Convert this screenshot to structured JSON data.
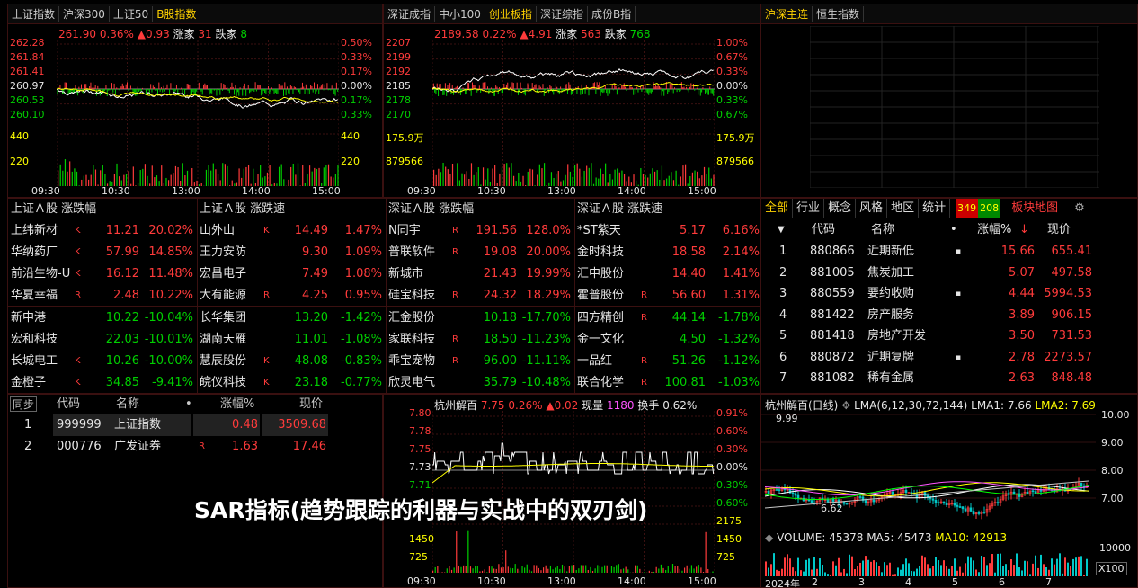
{
  "panel1": {
    "tabs": [
      "上证指数",
      "沪深300",
      "上证50",
      "B股指数"
    ],
    "active": 3,
    "header": {
      "price": "261.90",
      "pct": "0.36%",
      "chg": "▲0.93",
      "up_label": "涨家",
      "up": "31",
      "down_label": "跌家",
      "down": "8"
    },
    "yleft": [
      "262.28",
      "261.84",
      "261.41",
      "260.97",
      "260.53",
      "260.10"
    ],
    "yright": [
      "0.50%",
      "0.33%",
      "0.17%",
      "0.00%",
      "0.17%",
      "0.33%"
    ],
    "vol_left": [
      "440",
      "220"
    ],
    "vol_right": [
      "440",
      "220"
    ],
    "times": [
      "09:30",
      "10:30",
      "13:00",
      "14:00",
      "15:00"
    ]
  },
  "panel2": {
    "tabs": [
      "深证成指",
      "中小100",
      "创业板指",
      "深证综指",
      "成份B指"
    ],
    "active": 2,
    "header": {
      "price": "2189.58",
      "pct": "0.22%",
      "chg": "▲4.91",
      "up_label": "涨家",
      "up": "563",
      "down_label": "跌家",
      "down": "768"
    },
    "yleft": [
      "2207",
      "2199",
      "2192",
      "2185",
      "2178",
      "2170"
    ],
    "yright": [
      "1.00%",
      "0.67%",
      "0.33%",
      "0.00%",
      "0.33%",
      "0.67%"
    ],
    "vol_left": [
      "175.9万",
      "879566"
    ],
    "vol_right": [
      "175.9万",
      "879566"
    ],
    "times": [
      "09:30",
      "10:30",
      "13:00",
      "14:00",
      "15:00"
    ]
  },
  "panel3": {
    "tabs": [
      "沪深主连",
      "恒生指数"
    ],
    "active": 0
  },
  "rank": {
    "cols": [
      {
        "title": "上证Ａ股 涨跌幅",
        "rows": [
          [
            "上纬新材",
            "K",
            "11.21",
            "20.02%",
            "r"
          ],
          [
            "华纳药厂",
            "K",
            "57.99",
            "14.85%",
            "r"
          ],
          [
            "前沿生物-U",
            "K",
            "16.12",
            "11.48%",
            "r"
          ],
          [
            "华夏幸福",
            "R",
            "2.48",
            "10.22%",
            "r"
          ],
          [
            "新中港",
            "",
            "10.22",
            "-10.04%",
            "g"
          ],
          [
            "宏和科技",
            "",
            "22.03",
            "-10.01%",
            "g"
          ],
          [
            "长城电工",
            "K",
            "10.26",
            "-10.00%",
            "g"
          ],
          [
            "金橙子",
            "K",
            "34.85",
            "-9.41%",
            "g"
          ]
        ]
      },
      {
        "title": "上证Ａ股 涨跌速",
        "rows": [
          [
            "山外山",
            "K",
            "14.49",
            "1.47%",
            "r"
          ],
          [
            "王力安防",
            "",
            "9.30",
            "1.09%",
            "r"
          ],
          [
            "宏昌电子",
            "",
            "7.49",
            "1.08%",
            "r"
          ],
          [
            "大有能源",
            "R",
            "4.25",
            "0.95%",
            "r"
          ],
          [
            "长华集团",
            "",
            "13.20",
            "-1.42%",
            "g"
          ],
          [
            "湖南天雁",
            "",
            "11.01",
            "-1.08%",
            "g"
          ],
          [
            "慧辰股份",
            "K",
            "48.08",
            "-0.83%",
            "g"
          ],
          [
            "皖仪科技",
            "K",
            "23.18",
            "-0.77%",
            "g"
          ]
        ]
      },
      {
        "title": "深证Ａ股 涨跌幅",
        "rows": [
          [
            "N同宇",
            "R",
            "191.56",
            "128.0%",
            "r"
          ],
          [
            "普联软件",
            "R",
            "19.08",
            "20.00%",
            "r"
          ],
          [
            "新城市",
            "",
            "21.43",
            "19.99%",
            "r"
          ],
          [
            "硅宝科技",
            "R",
            "24.32",
            "18.29%",
            "r"
          ],
          [
            "汇金股份",
            "",
            "10.18",
            "-17.70%",
            "g"
          ],
          [
            "家联科技",
            "R",
            "18.50",
            "-11.23%",
            "g"
          ],
          [
            "乖宝宠物",
            "R",
            "96.00",
            "-11.11%",
            "g"
          ],
          [
            "欣灵电气",
            "",
            "35.79",
            "-10.48%",
            "g"
          ]
        ]
      },
      {
        "title": "深证Ａ股 涨跌速",
        "rows": [
          [
            "*ST紫天",
            "",
            "5.17",
            "6.16%",
            "r"
          ],
          [
            "金时科技",
            "",
            "18.58",
            "2.14%",
            "r"
          ],
          [
            "汇中股份",
            "",
            "14.40",
            "1.41%",
            "r"
          ],
          [
            "霍普股份",
            "R",
            "56.60",
            "1.31%",
            "r"
          ],
          [
            "四方精创",
            "R",
            "44.14",
            "-1.78%",
            "g"
          ],
          [
            "金一文化",
            "",
            "4.50",
            "-1.32%",
            "g"
          ],
          [
            "一品红",
            "R",
            "51.26",
            "-1.12%",
            "g"
          ],
          [
            "联合化学",
            "R",
            "100.81",
            "-1.03%",
            "g"
          ]
        ]
      }
    ]
  },
  "sector": {
    "tabs": [
      "全部",
      "行业",
      "概念",
      "风格",
      "地区",
      "统计"
    ],
    "count_up": "349",
    "count_down": "208",
    "map_label": "板块地图",
    "head": {
      "code": "代码",
      "name": "名称",
      "pct": "涨幅%",
      "price": "现价"
    },
    "rows": [
      [
        "1",
        "880866",
        "近期新低",
        "▪",
        "15.66",
        "655.41"
      ],
      [
        "2",
        "881005",
        "焦炭加工",
        "",
        "5.07",
        "497.58"
      ],
      [
        "3",
        "880559",
        "要约收购",
        "▪",
        "4.44",
        "5994.53"
      ],
      [
        "4",
        "881422",
        "房产服务",
        "",
        "3.89",
        "906.15"
      ],
      [
        "5",
        "881418",
        "房地产开发",
        "",
        "3.50",
        "731.53"
      ],
      [
        "6",
        "880872",
        "近期复牌",
        "▪",
        "2.78",
        "2273.57"
      ],
      [
        "7",
        "881082",
        "稀有金属",
        "",
        "2.63",
        "848.48"
      ]
    ]
  },
  "watch": {
    "sync": "同步",
    "head": {
      "code": "代码",
      "name": "名称",
      "pct": "涨幅%",
      "price": "现价"
    },
    "rows": [
      [
        "1",
        "999999",
        "上证指数",
        "",
        "0.48",
        "3509.68"
      ],
      [
        "2",
        "000776",
        "广发证券",
        "R",
        "1.63",
        "17.46"
      ]
    ]
  },
  "minute": {
    "header": {
      "name": "杭州解百",
      "price": "7.75",
      "pct": "0.26%",
      "chg": "▲0.02",
      "vol_label": "现量",
      "vol": "1180",
      "turn_label": "换手",
      "turn": "0.62%"
    },
    "yleft": [
      "7.80",
      "7.78",
      "7.75",
      "7.73",
      "7.71"
    ],
    "yright": [
      "0.91%",
      "0.60%",
      "0.30%",
      "0.00%",
      "0.30%",
      "0.60%"
    ],
    "vol_left": [
      "1450",
      "725"
    ],
    "vol_right": [
      "2175",
      "1450",
      "725"
    ],
    "times": [
      "09:30",
      "10:30",
      "13:00",
      "14:00",
      "15:00"
    ]
  },
  "kline": {
    "header": {
      "name": "杭州解百(日线)",
      "lma": "LMA(6,12,30,72,144)",
      "lma1_label": "LMA1:",
      "lma1": "7.66",
      "lma2_label": "LMA2:",
      "lma2": "7.69"
    },
    "yright": [
      "10.00",
      "9.00",
      "8.00",
      "7.00"
    ],
    "hi": "9.99",
    "lo": "6.62",
    "vol_header": {
      "name": "VOLUME:",
      "vol": "45378",
      "ma5_label": "MA5:",
      "ma5": "45473",
      "ma10_label": "MA10:",
      "ma10": "42913"
    },
    "vol_right": [
      "10000"
    ],
    "x100": "X100",
    "xaxis": [
      "2024年",
      "2",
      "3",
      "4",
      "5",
      "6",
      "7"
    ]
  },
  "overlay_title": "SAR指标(趋势跟踪的利器与实战中的双刃剑)",
  "colors": {
    "up": "#ff3b3b",
    "down": "#00d000",
    "price_line": "#ffffff",
    "avg_line": "#ffff00"
  }
}
